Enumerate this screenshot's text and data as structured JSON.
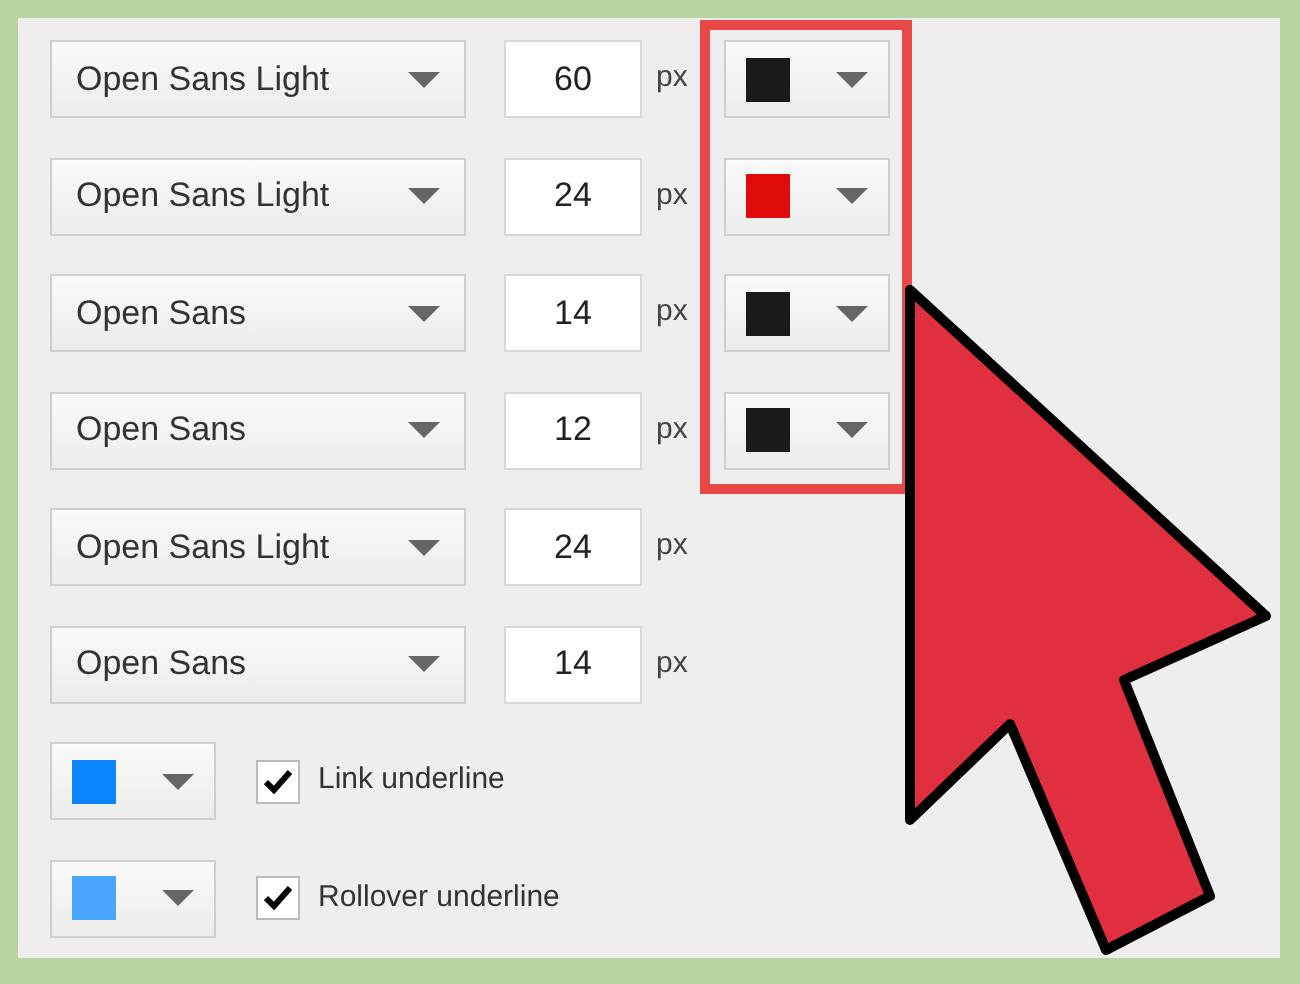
{
  "font_rows": [
    {
      "font": "Open Sans Light",
      "size": "60",
      "unit": "px",
      "color": "#1a1a1a"
    },
    {
      "font": "Open Sans Light",
      "size": "24",
      "unit": "px",
      "color": "#e00b0b"
    },
    {
      "font": "Open Sans",
      "size": "14",
      "unit": "px",
      "color": "#1a1a1a"
    },
    {
      "font": "Open Sans",
      "size": "12",
      "unit": "px",
      "color": "#1a1a1a"
    },
    {
      "font": "Open Sans Light",
      "size": "24",
      "unit": "px"
    },
    {
      "font": "Open Sans",
      "size": "14",
      "unit": "px"
    }
  ],
  "link_rows": [
    {
      "color": "#0a84ff",
      "checked": true,
      "label": "Link underline"
    },
    {
      "color": "#4aa6ff",
      "checked": true,
      "label": "Rollover underline"
    }
  ]
}
